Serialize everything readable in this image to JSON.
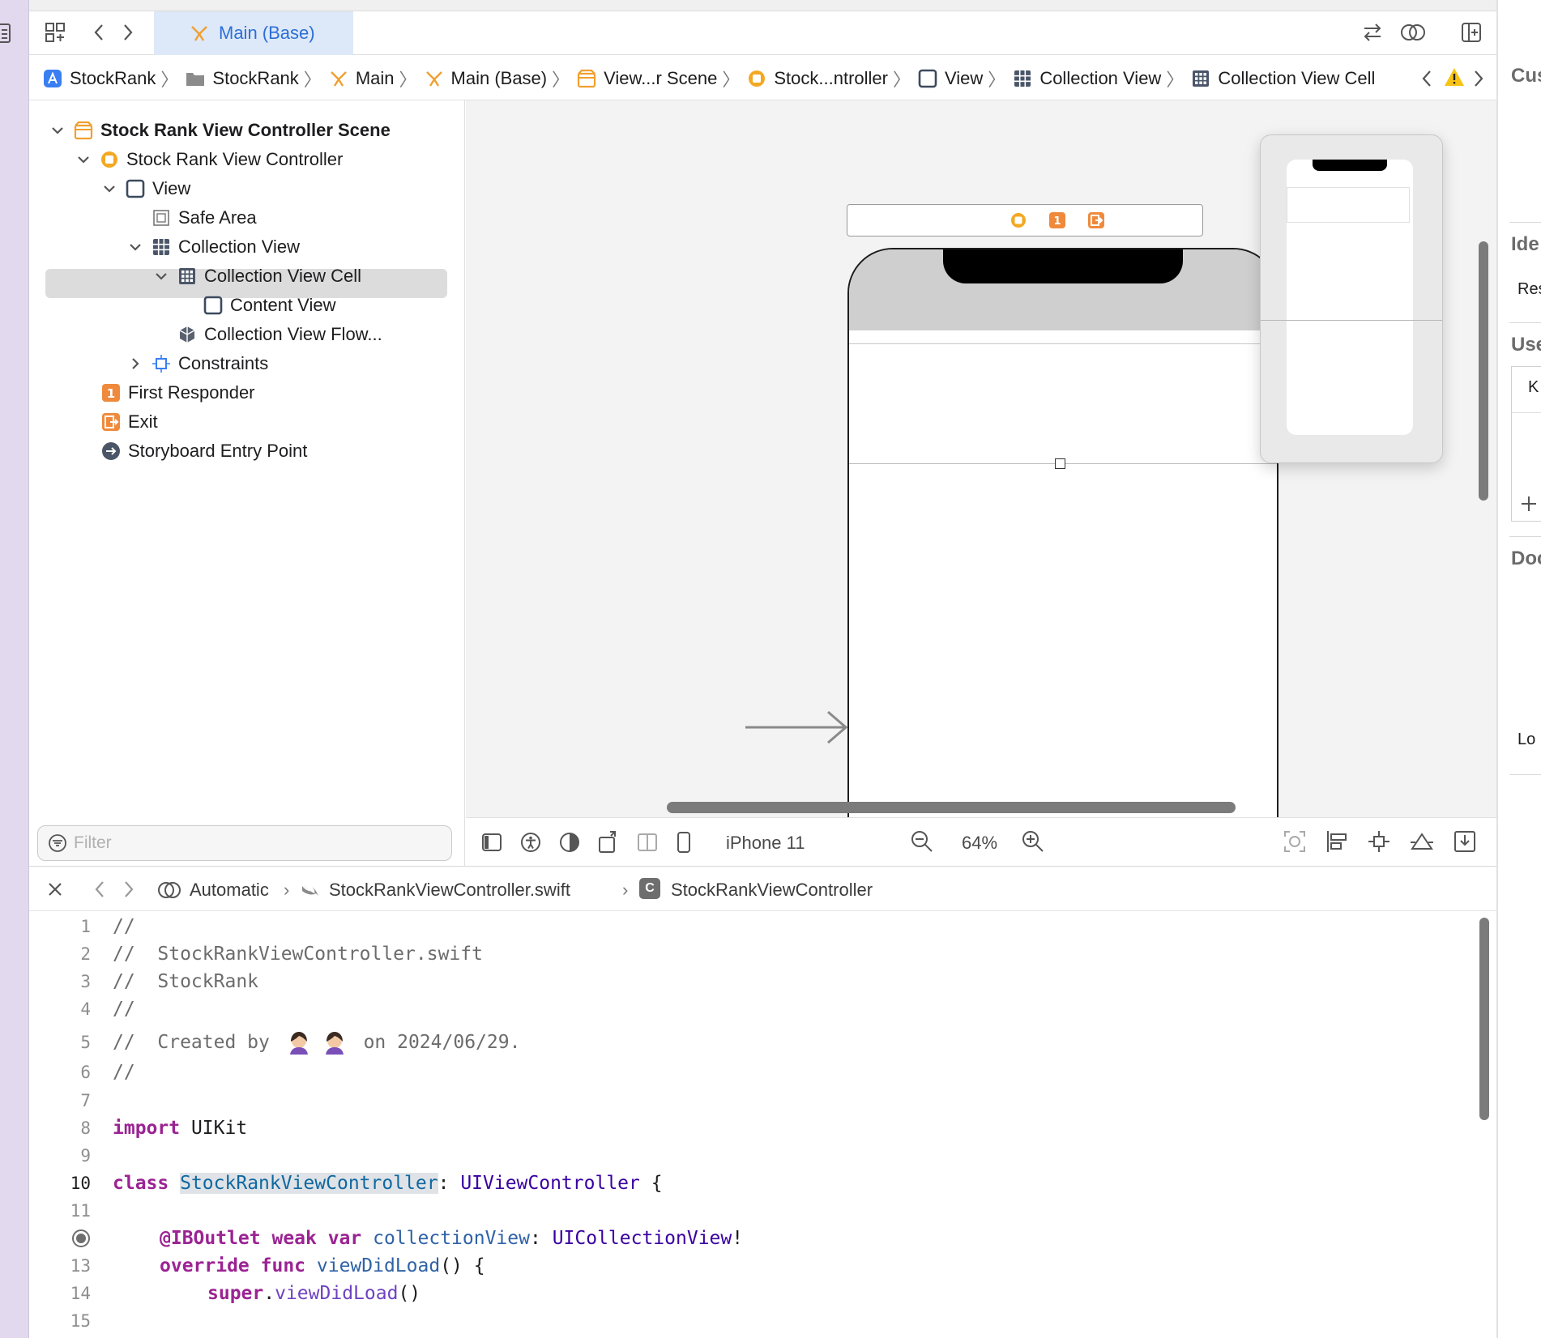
{
  "tab": {
    "active_label": "Main (Base)"
  },
  "breadcrumb": [
    {
      "label": "StockRank",
      "icon": "app-icon"
    },
    {
      "label": "StockRank",
      "icon": "folder-icon"
    },
    {
      "label": "Main",
      "icon": "storyboard-icon"
    },
    {
      "label": "Main (Base)",
      "icon": "storyboard-icon"
    },
    {
      "label": "View...r Scene",
      "icon": "scene-icon"
    },
    {
      "label": "Stock...ntroller",
      "icon": "view-controller-icon"
    },
    {
      "label": "View",
      "icon": "view-icon"
    },
    {
      "label": "Collection View",
      "icon": "collection-view-icon"
    },
    {
      "label": "Collection View Cell",
      "icon": "collection-cell-icon"
    }
  ],
  "outline": {
    "items": [
      {
        "label": "Stock Rank View Controller Scene",
        "bold": true
      },
      {
        "label": "Stock Rank View Controller"
      },
      {
        "label": "View"
      },
      {
        "label": "Safe Area"
      },
      {
        "label": "Collection View"
      },
      {
        "label": "Collection View Cell",
        "selected": true
      },
      {
        "label": "Content View"
      },
      {
        "label": "Collection View Flow..."
      },
      {
        "label": "Constraints"
      },
      {
        "label": "First Responder"
      },
      {
        "label": "Exit"
      },
      {
        "label": "Storyboard Entry Point"
      }
    ],
    "filter_placeholder": "Filter"
  },
  "canvas": {
    "device": "iPhone 11",
    "zoom": "64%",
    "first_responder_badge": "1"
  },
  "editor": {
    "mode": "Automatic",
    "file": "StockRankViewController.swift",
    "symbol": "StockRankViewController",
    "symbol_badge": "C"
  },
  "code": {
    "line_numbers": [
      "1",
      "2",
      "3",
      "4",
      "5",
      "6",
      "7",
      "8",
      "9",
      "10",
      "11",
      "",
      "13",
      "14",
      "15"
    ],
    "line1": "//",
    "line2": "//  StockRankViewController.swift",
    "line3": "//  StockRank",
    "line4": "//",
    "line5_a": "//  Created by ",
    "line5_b": " on 2024/06/29.",
    "line6": "//",
    "line8_kw": "import",
    "line8_rest": " UIKit",
    "line10_kw": "class",
    "line10_name": "StockRankViewController",
    "line10_colon": ": ",
    "line10_type": "UIViewController",
    "line10_brace": " {",
    "line12_attr": "@IBOutlet",
    "line12_kw": " weak var ",
    "line12_name": "collectionView",
    "line12_colon": ": ",
    "line12_type": "UICollectionView",
    "line12_end": "!",
    "line13_kw": "override func ",
    "line13_name": "viewDidLoad",
    "line13_end": "() {",
    "line14_kw": "super",
    "line14_dot": ".",
    "line14_name": "viewDidLoad",
    "line14_end": "()"
  },
  "inspector": {
    "header1": "Cus",
    "header2": "Ide",
    "text_res": "Res",
    "header3": "Use",
    "text_k": "K",
    "header4": "Doc",
    "text_lo": "Lo"
  },
  "colors": {
    "accent": "#2b6fd6",
    "storyboard_orange": "#f0a030",
    "first_responder": "#ef8a3c",
    "keyword": "#9b2393",
    "type": "#3900a0",
    "selection": "#dcdcdc"
  }
}
